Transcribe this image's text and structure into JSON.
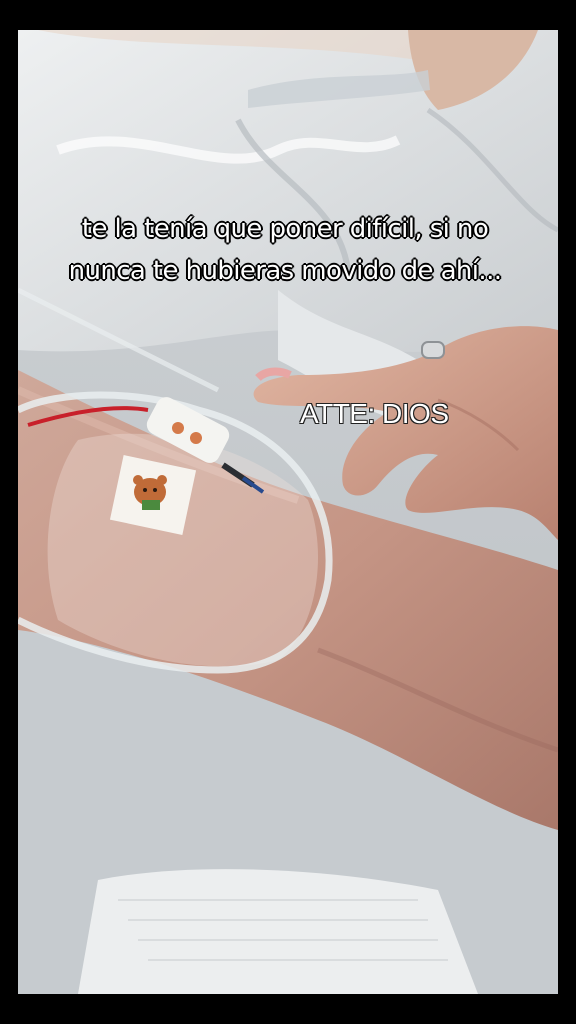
{
  "overlay": {
    "caption": "te la tenía que poner difícil, si no nunca te hubieras movido de ahí...",
    "signature": "ATTE: DIOS"
  }
}
